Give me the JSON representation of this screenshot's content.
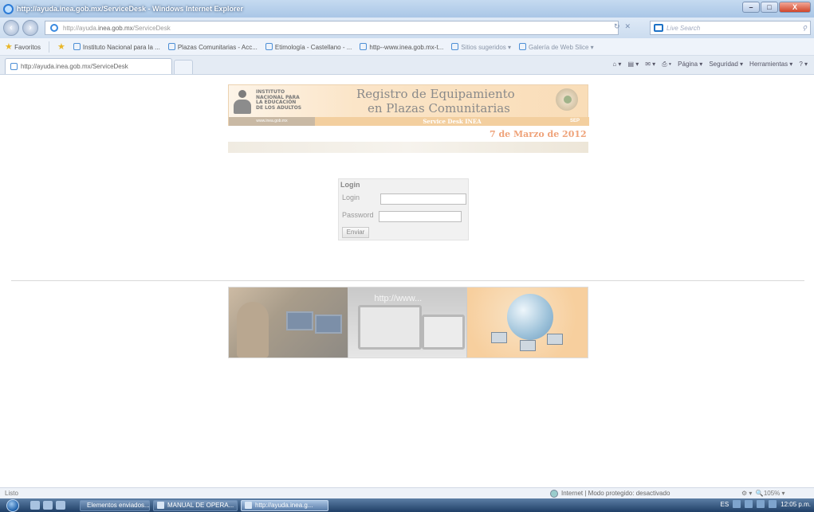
{
  "window": {
    "title": "http://ayuda.inea.gob.mx/ServiceDesk - Windows Internet Explorer",
    "minimize": "–",
    "maximize": "□",
    "close": "X"
  },
  "address": {
    "url_prefix": "http://ayuda.",
    "url_host": "inea.gob.mx",
    "url_path": "/ServiceDesk",
    "search_placeholder": "Live Search"
  },
  "favorites": {
    "label": "Favoritos",
    "items": [
      "Instituto Nacional para la ...",
      "Plazas Comunitarias - Acc...",
      "Etimología - Castellano - ...",
      "http--www.inea.gob.mx-t...",
      "Sitios sugeridos ▾",
      "Galería de Web Slice ▾"
    ]
  },
  "tab": {
    "title": "http://ayuda.inea.gob.mx/ServiceDesk"
  },
  "command_bar": [
    "Página ▾",
    "Seguridad ▾",
    "Herramientas ▾"
  ],
  "banner": {
    "logo_lines": [
      "INSTITUTO",
      "NACIONAL PARA",
      "LA EDUCACIÓN",
      "DE LOS ADULTOS"
    ],
    "logo_url": "www.inea.gob.mx",
    "title_line1": "Registro de Equipamiento",
    "title_line2": "en Plazas Comunitarias",
    "subtitle": "Service Desk INEA",
    "sep": "SEP"
  },
  "date": "7 de Marzo de 2012",
  "login": {
    "header": "Login",
    "user_label": "Login",
    "user_value": "",
    "password_label": "Password",
    "password_value": "",
    "submit": "Enviar"
  },
  "images": {
    "middle_url": "http://www..."
  },
  "status": {
    "left": "Listo",
    "zone": "Internet | Modo protegido: desactivado",
    "zoom": "105%"
  },
  "taskbar": {
    "buttons": [
      "Elementos enviados...",
      "MANUAL DE OPERA...",
      "http://ayuda.inea.g..."
    ],
    "lang": "ES",
    "time": "12:05 p.m."
  }
}
